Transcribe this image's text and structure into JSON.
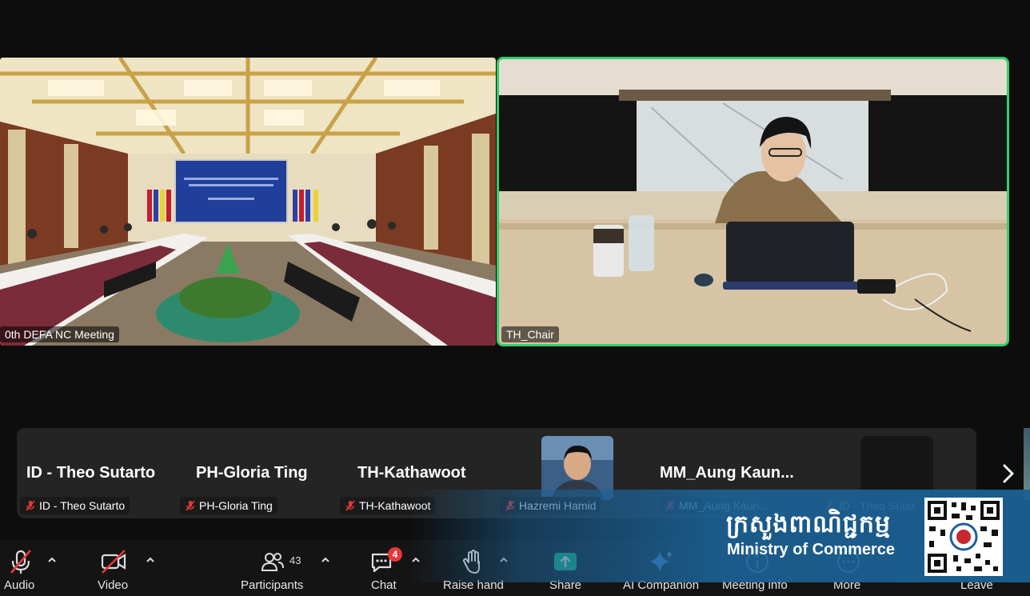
{
  "colors": {
    "active_speaker_border": "#2fd16a",
    "muted_red": "#e5383b",
    "toolbar_bg": "#141414",
    "share_green": "#19c37d",
    "banner_blue": "#1c6296"
  },
  "videos": {
    "room_label": "0th DEFA NC Meeting",
    "chair_label": "TH_Chair"
  },
  "gallery": {
    "tiles": [
      {
        "big_name": "ID - Theo Sutarto",
        "label": "ID - Theo Sutarto"
      },
      {
        "big_name": "PH-Gloria Ting",
        "label": "PH-Gloria Ting"
      },
      {
        "big_name": "TH-Kathawoot",
        "label": "TH-Kathawoot"
      },
      {
        "big_name": "",
        "label": "Hazremi Hamid"
      },
      {
        "big_name": "MM_Aung  Kaun...",
        "label": "MM_Aung Kaun..."
      },
      {
        "big_name": "",
        "label": "ID - Theo Sutar"
      }
    ],
    "next_icon": "chevron-right-icon"
  },
  "toolbar": {
    "audio": {
      "label": "Audio",
      "icon": "mic-muted-icon"
    },
    "video": {
      "label": "Video",
      "icon": "video-off-icon"
    },
    "participants": {
      "label": "Participants",
      "count": "43",
      "icon": "participants-icon"
    },
    "chat": {
      "label": "Chat",
      "badge": "4",
      "icon": "chat-icon"
    },
    "raise_hand": {
      "label": "Raise hand",
      "icon": "hand-icon"
    },
    "share": {
      "label": "Share",
      "icon": "share-arrow-icon"
    },
    "ai_companion": {
      "label": "AI Companion",
      "icon": "sparkle-icon"
    },
    "meeting_info": {
      "label": "Meeting info",
      "icon": "info-icon"
    },
    "more": {
      "label": "More",
      "icon": "more-dots-icon"
    },
    "leave": {
      "label": "Leave"
    }
  },
  "watermark": {
    "khmer": "ក្រសួងពាណិជ្ជកម្ម",
    "english": "Ministry of Commerce"
  }
}
